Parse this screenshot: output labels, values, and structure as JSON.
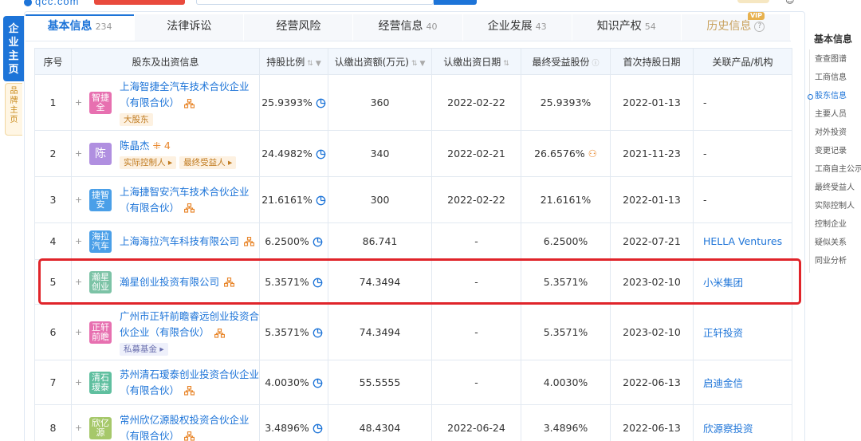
{
  "tabs": [
    {
      "label": "基本信息",
      "count": "234",
      "active": true
    },
    {
      "label": "法律诉讼",
      "count": ""
    },
    {
      "label": "经营风险",
      "count": ""
    },
    {
      "label": "经营信息",
      "count": "40"
    },
    {
      "label": "企业发展",
      "count": "43"
    },
    {
      "label": "知识产权",
      "count": "54"
    },
    {
      "label": "历史信息",
      "count": "",
      "vip": "VIP"
    }
  ],
  "left_tabs": {
    "main": "企业主页",
    "brand": "品牌主页"
  },
  "table": {
    "headers": [
      "序号",
      "股东及出资信息",
      "持股比例",
      "认缴出资额(万元)",
      "认缴出资日期",
      "最终受益股份",
      "首次持股日期",
      "关联产品/机构"
    ],
    "rows": [
      {
        "no": "1",
        "avatar": "智捷全",
        "avatar_color": "#e770b0",
        "name": "上海智捷全汽车技术合伙企业（有限合伙）",
        "tags": [
          "大股东"
        ],
        "tag_style": "orange",
        "ratio": "25.9393%",
        "amount": "360",
        "date": "2022-02-22",
        "benefit": "25.9393%",
        "first": "2022-01-13",
        "related": "-"
      },
      {
        "no": "2",
        "avatar": "陈",
        "avatar_color": "#b08fe0",
        "name": "陈晶杰",
        "name_extra": "4",
        "tags": [
          "实际控制人",
          "最终受益人"
        ],
        "tag_style": "orange",
        "ratio": "24.4982%",
        "amount": "340",
        "date": "2022-02-21",
        "benefit": "26.6576%",
        "first": "2021-11-23",
        "related": "-"
      },
      {
        "no": "3",
        "avatar": "捷智安",
        "avatar_color": "#4a9fe8",
        "name": "上海捷智安汽车技术合伙企业（有限合伙）",
        "tags": [],
        "ratio": "21.6161%",
        "amount": "300",
        "date": "2022-02-22",
        "benefit": "21.6161%",
        "first": "2022-01-13",
        "related": "-"
      },
      {
        "no": "4",
        "avatar": "海拉汽车",
        "avatar_color": "#4a9fe8",
        "name": "上海海拉汽车科技有限公司",
        "tags": [],
        "ratio": "6.2500%",
        "amount": "86.741",
        "date": "-",
        "benefit": "6.2500%",
        "first": "2022-07-21",
        "related": "HELLA Ventures"
      },
      {
        "no": "5",
        "avatar": "瀚星创业",
        "avatar_color": "#7cc3a6",
        "name": "瀚星创业投资有限公司",
        "tags": [],
        "ratio": "5.3571%",
        "amount": "74.3494",
        "date": "-",
        "benefit": "5.3571%",
        "first": "2023-02-10",
        "related": "小米集团"
      },
      {
        "no": "6",
        "avatar": "正轩前瞻",
        "avatar_color": "#e770b0",
        "name": "广州市正轩前瞻睿远创业投资合伙企业（有限合伙）",
        "tags": [
          "私募基金"
        ],
        "tag_style": "blue",
        "ratio": "5.3571%",
        "amount": "74.3494",
        "date": "-",
        "benefit": "5.3571%",
        "first": "2023-02-10",
        "related": "正轩投资"
      },
      {
        "no": "7",
        "avatar": "清石瑷泰",
        "avatar_color": "#5fbf9f",
        "name": "苏州清石瑷泰创业投资合伙企业（有限合伙）",
        "tags": [],
        "ratio": "4.0030%",
        "amount": "55.5555",
        "date": "-",
        "benefit": "4.0030%",
        "first": "2022-06-13",
        "related": "启迪金信"
      },
      {
        "no": "8",
        "avatar": "欣亿源",
        "avatar_color": "#a6c86a",
        "name": "常州欣亿源股权投资合伙企业（有限合伙）",
        "tags": [],
        "ratio": "3.4896%",
        "amount": "48.4304",
        "date": "2022-06-24",
        "benefit": "3.4896%",
        "first": "2022-06-13",
        "related": "欣源察投资"
      }
    ]
  },
  "right_nav": {
    "head": "基本信息",
    "items": [
      "查查图谱",
      "工商信息",
      "股东信息",
      "主要人员",
      "对外投资",
      "变更记录",
      "工商自主公示",
      "最终受益人",
      "实际控制人",
      "控制企业",
      "疑似关系",
      "同业分析"
    ],
    "active_index": 2
  },
  "colors": {
    "accent": "#1d74d8",
    "highlight": "#e0242a"
  }
}
